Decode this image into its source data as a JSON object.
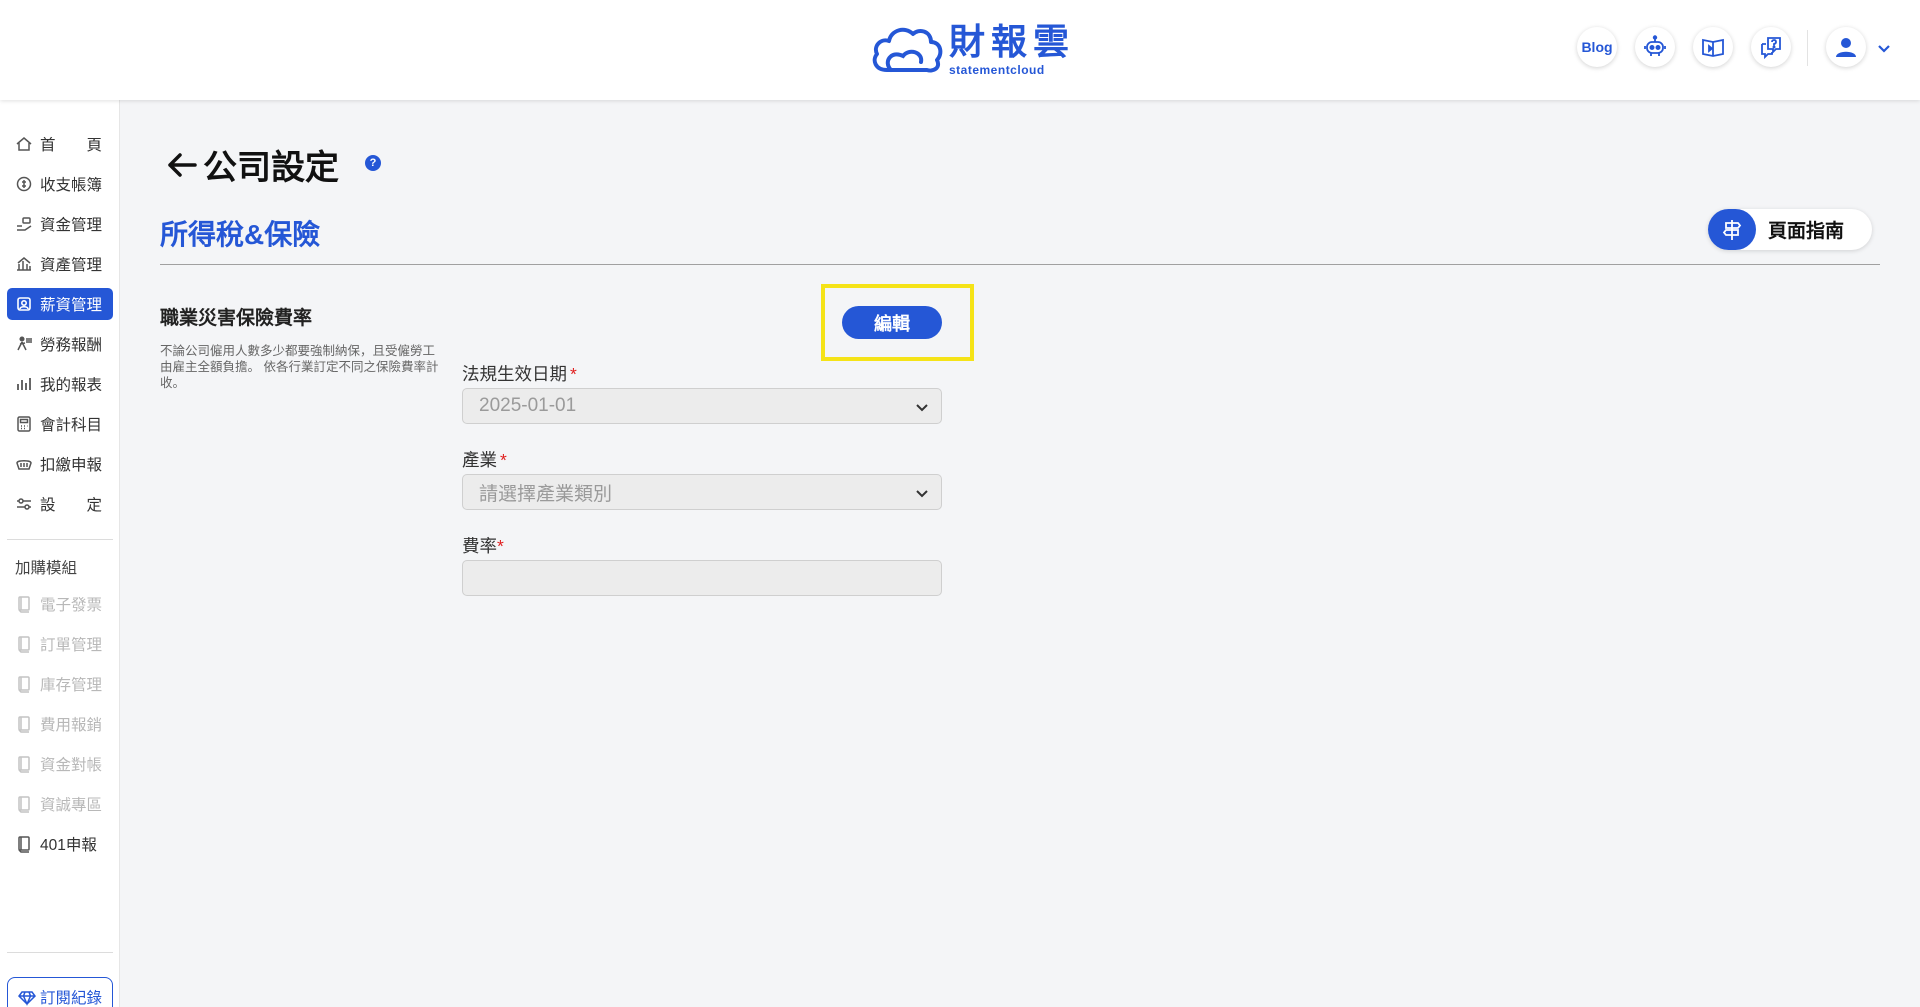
{
  "header": {
    "logo_main": "財報雲",
    "logo_sub": "statementcloud",
    "blog_label": "Blog",
    "buttons": [
      "robot-icon",
      "video-book-icon",
      "help-chat-icon"
    ],
    "avatar_icon": "user-icon"
  },
  "sidebar": {
    "items": [
      {
        "label": "首頁",
        "icon": "home-icon"
      },
      {
        "label": "收支帳簿",
        "icon": "coin-icon"
      },
      {
        "label": "資金管理",
        "icon": "money-hand-icon"
      },
      {
        "label": "資產管理",
        "icon": "building-icon"
      },
      {
        "label": "薪資管理",
        "icon": "payroll-icon",
        "active": true
      },
      {
        "label": "勞務報酬",
        "icon": "worker-icon"
      },
      {
        "label": "我的報表",
        "icon": "bar-chart-icon"
      },
      {
        "label": "會計科目",
        "icon": "calculator-icon"
      },
      {
        "label": "扣繳申報",
        "icon": "tax-icon"
      },
      {
        "label": "設定",
        "icon": "sliders-icon"
      }
    ],
    "addon_title": "加購模組",
    "addons": [
      {
        "label": "電子發票",
        "disabled": true
      },
      {
        "label": "訂單管理",
        "disabled": true
      },
      {
        "label": "庫存管理",
        "disabled": true
      },
      {
        "label": "費用報銷",
        "disabled": true
      },
      {
        "label": "資金對帳",
        "disabled": true
      },
      {
        "label": "資誠專區",
        "disabled": true
      },
      {
        "label": "401申報",
        "disabled": false
      }
    ],
    "subscription_label": "訂閱紀錄"
  },
  "page": {
    "title": "公司設定",
    "help": "?",
    "section_title": "所得稅&保險",
    "guide_label": "頁面指南"
  },
  "block": {
    "title": "職業災害保險費率",
    "description": "不論公司僱用人數多少都要強制納保，且受僱勞工由雇主全額負擔。 依各行業訂定不同之保險費率計收。",
    "edit_label": "編輯",
    "fields": {
      "date_label": "法規生效日期",
      "date_value": "2025-01-01",
      "industry_label": "產業",
      "industry_placeholder": "請選擇產業類別",
      "rate_label": "費率",
      "rate_value": "",
      "required_mark": "*"
    }
  },
  "colors": {
    "brand": "#2557d6",
    "highlight": "#f5e317",
    "required": "#e02020"
  }
}
